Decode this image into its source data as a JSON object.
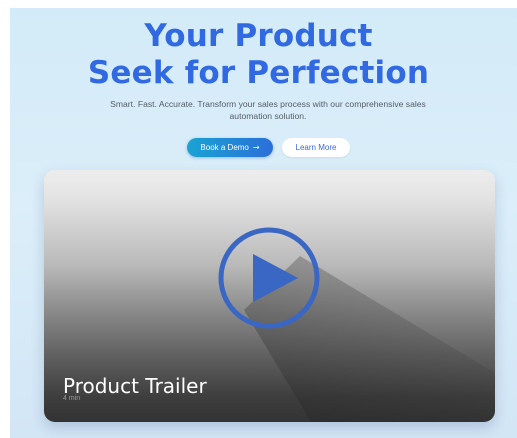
{
  "hero": {
    "title_line1": "Your Product",
    "title_line2": "Seek for Perfection",
    "subtitle": "Smart. Fast. Accurate. Transform your sales process with our comprehensive sales automation solution."
  },
  "actions": {
    "primary_label": "Book a Demo",
    "primary_icon": "arrow-right-icon",
    "secondary_label": "Learn More"
  },
  "video": {
    "title": "Product Trailer",
    "duration": "4 min",
    "play_icon": "play-icon"
  },
  "colors": {
    "accent": "#3169e3",
    "page_background": "#d8ecf8",
    "primary_button_start": "#1aa3d4",
    "primary_button_end": "#2b6fd9",
    "play_button": "#3a66c4"
  }
}
